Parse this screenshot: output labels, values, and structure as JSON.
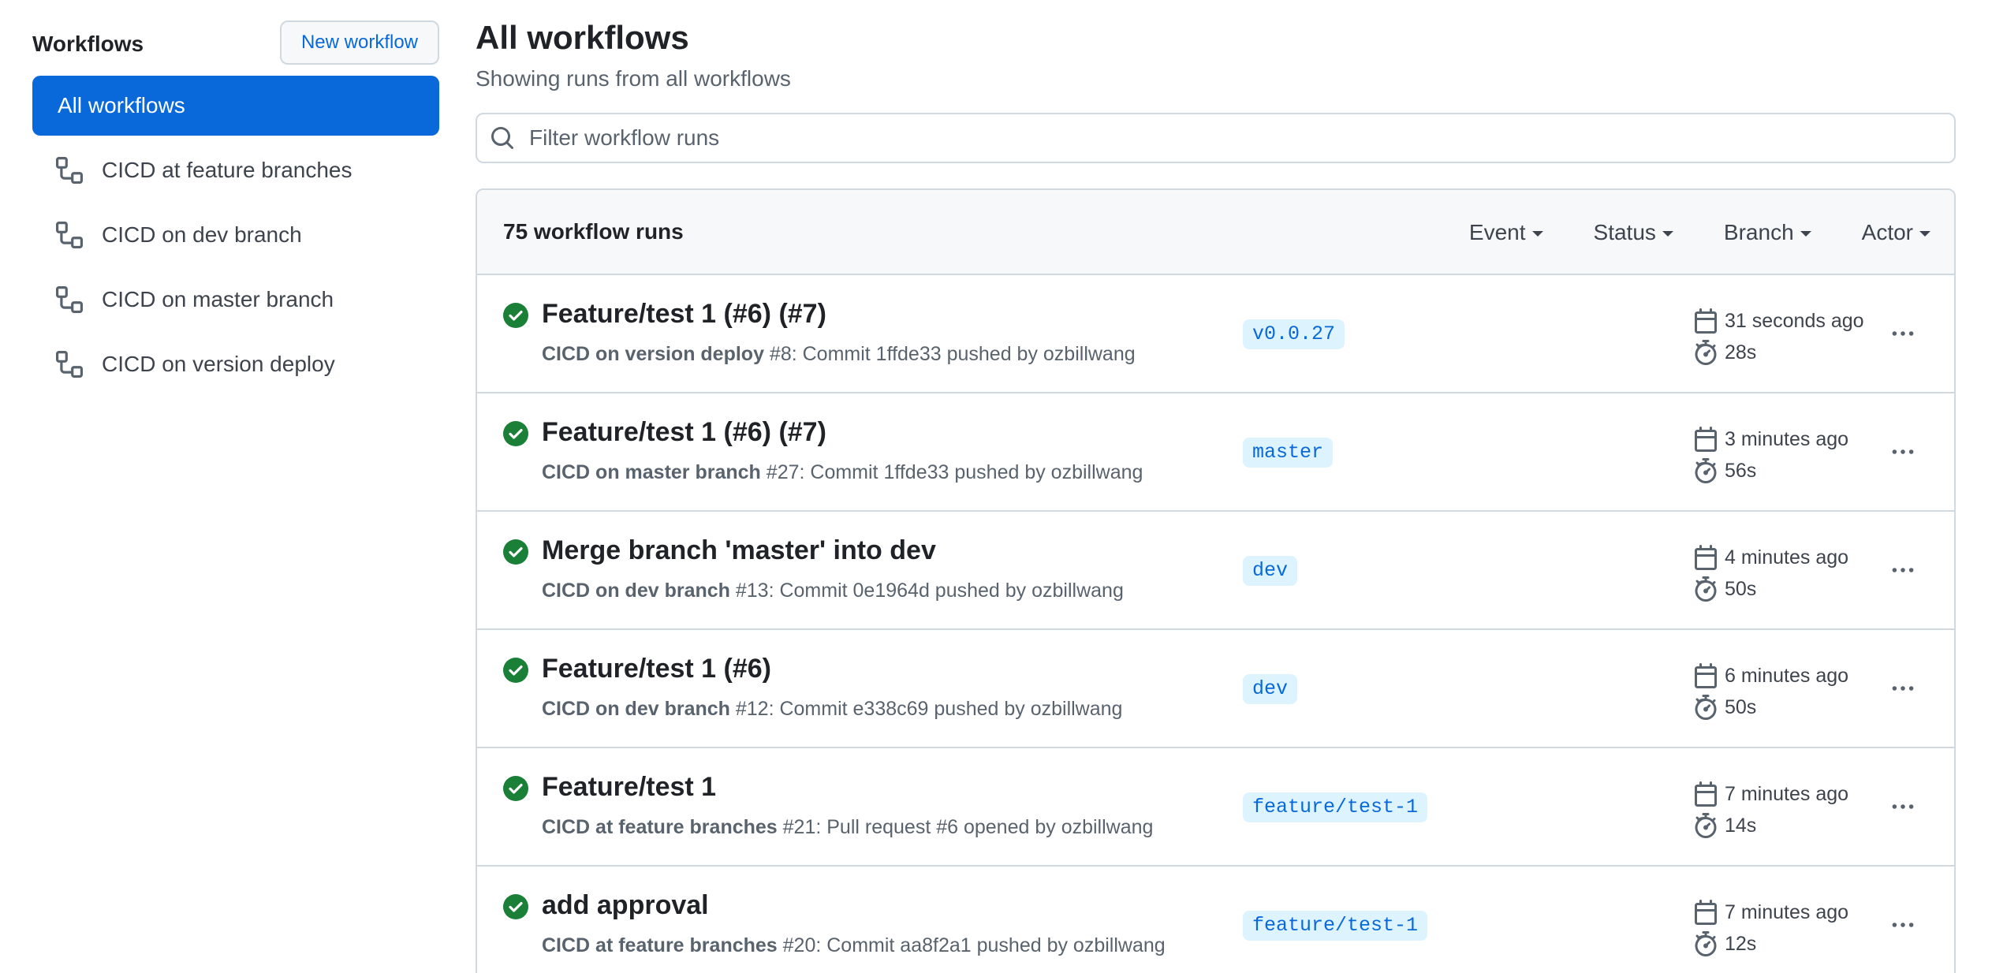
{
  "sidebar": {
    "title": "Workflows",
    "new_button": "New workflow",
    "items": [
      {
        "label": "All workflows",
        "active": true
      },
      {
        "label": "CICD at feature branches"
      },
      {
        "label": "CICD on dev branch"
      },
      {
        "label": "CICD on master branch"
      },
      {
        "label": "CICD on version deploy"
      }
    ]
  },
  "main": {
    "title": "All workflows",
    "subtitle": "Showing runs from all workflows",
    "search_placeholder": "Filter workflow runs",
    "runs_count": "75 workflow runs",
    "filters": [
      "Event",
      "Status",
      "Branch",
      "Actor"
    ],
    "runs": [
      {
        "title": "Feature/test 1 (#6) (#7)",
        "workflow": "CICD on version deploy",
        "detail": " #8: Commit 1ffde33 pushed by ozbillwang",
        "branch": "v0.0.27",
        "time": "31 seconds ago",
        "duration": "28s"
      },
      {
        "title": "Feature/test 1 (#6) (#7)",
        "workflow": "CICD on master branch",
        "detail": " #27: Commit 1ffde33 pushed by ozbillwang",
        "branch": "master",
        "time": "3 minutes ago",
        "duration": "56s"
      },
      {
        "title": "Merge branch 'master' into dev",
        "workflow": "CICD on dev branch",
        "detail": " #13: Commit 0e1964d pushed by ozbillwang",
        "branch": "dev",
        "time": "4 minutes ago",
        "duration": "50s"
      },
      {
        "title": "Feature/test 1 (#6)",
        "workflow": "CICD on dev branch",
        "detail": " #12: Commit e338c69 pushed by ozbillwang",
        "branch": "dev",
        "time": "6 minutes ago",
        "duration": "50s"
      },
      {
        "title": "Feature/test 1",
        "workflow": "CICD at feature branches",
        "detail": " #21: Pull request #6 opened by ozbillwang",
        "branch": "feature/test-1",
        "time": "7 minutes ago",
        "duration": "14s"
      },
      {
        "title": "add approval",
        "workflow": "CICD at feature branches",
        "detail": " #20: Commit aa8f2a1 pushed by ozbillwang",
        "branch": "feature/test-1",
        "time": "7 minutes ago",
        "duration": "12s"
      }
    ]
  },
  "colors": {
    "accent": "#0969da",
    "success": "#1a7f37",
    "branch_bg": "#ddf4ff",
    "border": "#d1d9e0"
  },
  "icons": {
    "workflow": "workflow-icon",
    "search": "search-icon",
    "status": "check-circle-icon",
    "calendar": "calendar-icon",
    "stopwatch": "stopwatch-icon",
    "more": "kebab-horizontal-icon"
  }
}
